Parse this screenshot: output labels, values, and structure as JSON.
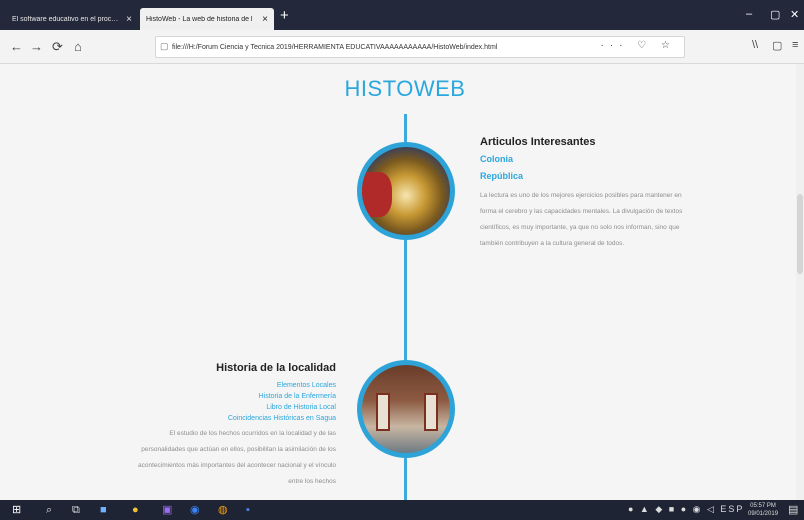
{
  "browser": {
    "tabs": [
      {
        "label": "El software educativo en el proceso"
      },
      {
        "label": "HistoWeb - La web de historia de l"
      }
    ],
    "new_tab": "+",
    "window_controls": [
      "–",
      "▢",
      "✕"
    ],
    "nav": {
      "back": "←",
      "forward": "→",
      "reload": "⟳",
      "home": "⌂"
    },
    "url": "file:///H:/Forum Ciencia y Tecnica 2019/HERRAMIENTA EDUCATIVAAAAAAAAAAA/HistoWeb/index.html",
    "url_actions": "··· ♡ ☆",
    "tools": [
      "\\\\",
      "▢",
      "≡"
    ]
  },
  "page": {
    "title": "HISTOWEB",
    "section1": {
      "heading": "Articulos Interesantes",
      "links": [
        "Colonia",
        "República"
      ],
      "paragraph": "La lectura es uno de los mejores ejercicios posibles para mantener en forma el cerebro y las capacidades mentales. La divulgación de textos científicos, es muy importante, ya que no solo nos informan, sino que también contribuyen a la cultura general de todos."
    },
    "section2": {
      "heading": "Historia de la localidad",
      "links": [
        "Elementos Locales",
        "Historia de la Enfermería",
        "Libro de Historia Local",
        "Coincidencias Históricas en Sagua"
      ],
      "paragraph": "El estudio de los hechos ocurridos en la localidad y de las personalidades que actúan en ellos, posibilitan la asimilación de los acontecimientos más importantes del acontecer nacional y el vínculo entre los hechos"
    }
  },
  "taskbar": {
    "icons": [
      "windows-start-icon",
      "search-icon",
      "task-view-icon",
      "store-icon",
      "chrome-icon",
      "photos-icon",
      "edge-icon",
      "firefox-icon",
      "word-icon"
    ],
    "tray": "● ▲ ◆ ■ ● ◉ ◁ ESP",
    "time": "05:57 PM",
    "date": "09/01/2019",
    "colors": {
      "accent": "#2aa7dd",
      "taskbar": "#1e2433"
    }
  }
}
